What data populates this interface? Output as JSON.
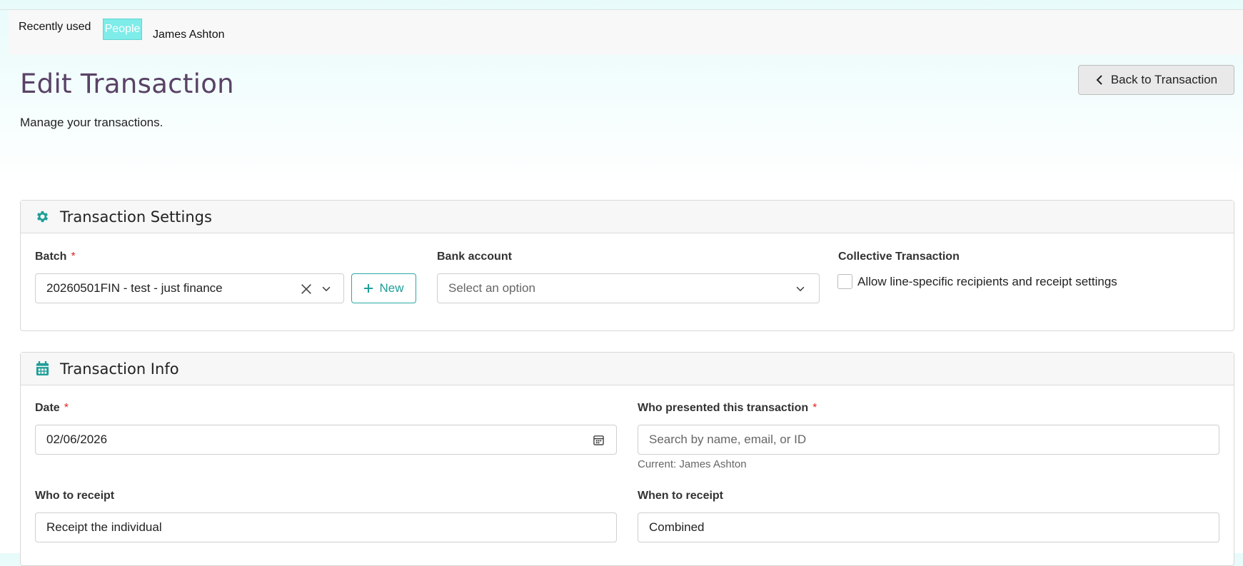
{
  "recently_used": {
    "label": "Recently used",
    "chip": "People",
    "name": "James Ashton"
  },
  "header": {
    "title": "Edit Transaction",
    "subtitle": "Manage your transactions.",
    "back_button": "Back to Transaction"
  },
  "settings_card": {
    "title": "Transaction Settings",
    "icon": "gear-icon",
    "batch": {
      "label": "Batch",
      "required": "*",
      "value": "20260501FIN - test - just finance",
      "new_button": "New"
    },
    "bank_account": {
      "label": "Bank account",
      "placeholder": "Select an option"
    },
    "collective": {
      "label": "Collective Transaction",
      "checkbox_label": "Allow line-specific recipients and receipt settings",
      "checked": false
    }
  },
  "info_card": {
    "title": "Transaction Info",
    "icon": "calendar-icon",
    "date": {
      "label": "Date",
      "required": "*",
      "value": "02/06/2026"
    },
    "presenter": {
      "label": "Who presented this transaction",
      "required": "*",
      "placeholder": "Search by name, email, or ID",
      "current": "Current: James Ashton"
    },
    "who_to_receipt": {
      "label": "Who to receipt",
      "value": "Receipt the individual"
    },
    "when_to_receipt": {
      "label": "When to receipt",
      "value": "Combined"
    }
  },
  "colors": {
    "accent": "#1f9e98",
    "title": "#5a4266",
    "required": "#e02424",
    "chip": "#7eece8"
  }
}
